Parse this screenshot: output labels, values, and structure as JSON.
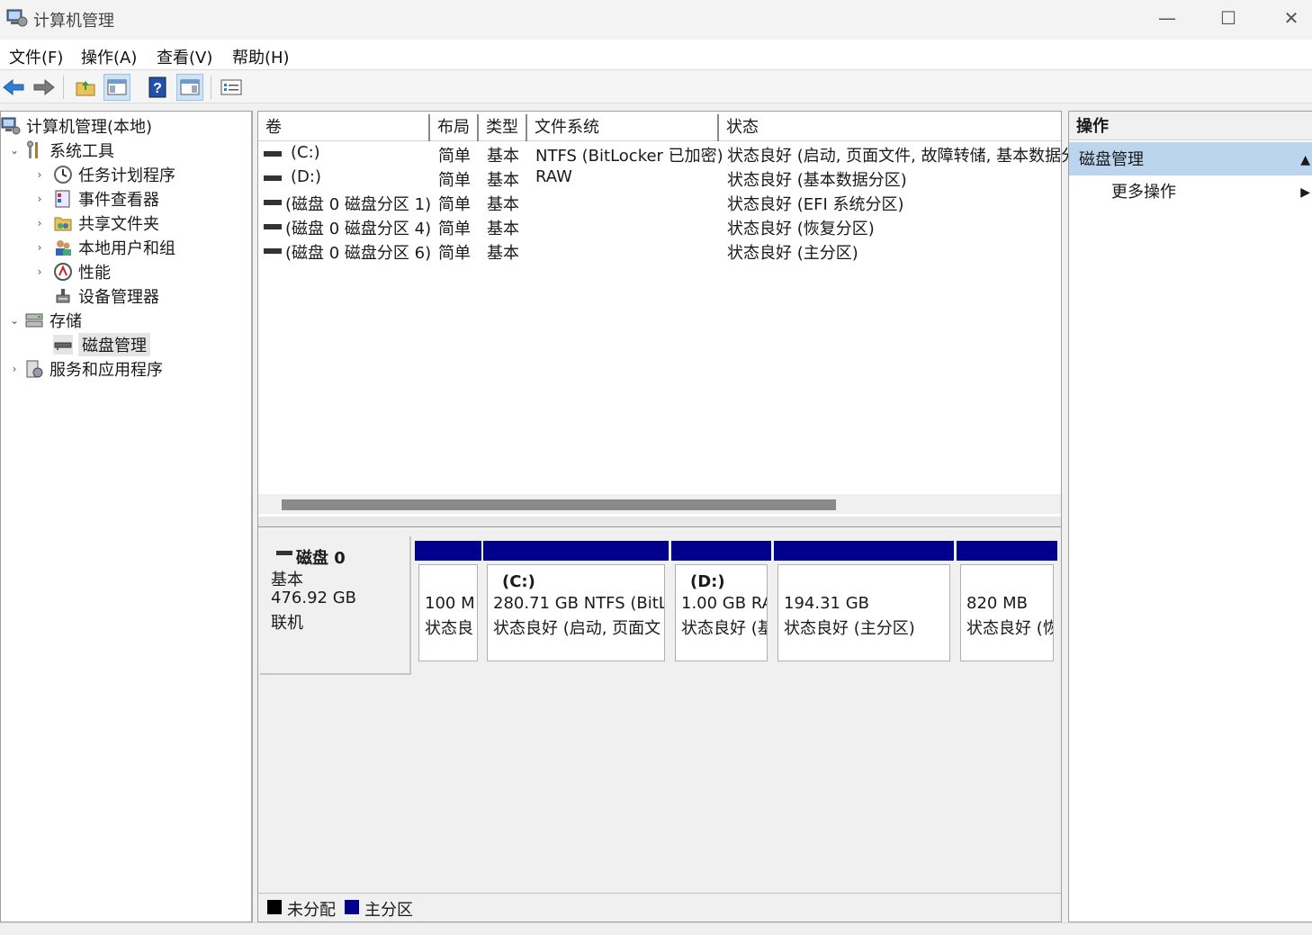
{
  "window": {
    "title": "计算机管理",
    "minimize_icon": "minimize-icon",
    "maximize_icon": "maximize-icon",
    "close_icon": "close-icon"
  },
  "menu": [
    "文件(F)",
    "操作(A)",
    "查看(V)",
    "帮助(H)"
  ],
  "toolbar": [
    "back-arrow-icon",
    "forward-arrow-icon",
    "folder-up-icon",
    "console-tree-icon",
    "help-icon",
    "action-pane-icon",
    "properties-icon"
  ],
  "tree": {
    "root": "计算机管理(本地)",
    "system_tools": "系统工具",
    "task_scheduler": "任务计划程序",
    "event_viewer": "事件查看器",
    "shared_folders": "共享文件夹",
    "local_users": "本地用户和组",
    "performance": "性能",
    "device_manager": "设备管理器",
    "storage": "存储",
    "disk_management": "磁盘管理",
    "services": "服务和应用程序"
  },
  "volume_table": {
    "headers": {
      "volume": "卷",
      "layout": "布局",
      "type": "类型",
      "fs": "文件系统",
      "status": "状态"
    },
    "rows": [
      {
        "volume": "(C:)",
        "layout": "简单",
        "type": "基本",
        "fs": "NTFS (BitLocker 已加密)",
        "status": "状态良好 (启动, 页面文件, 故障转储, 基本数据分"
      },
      {
        "volume": "(D:)",
        "layout": "简单",
        "type": "基本",
        "fs": "RAW",
        "status": "状态良好 (基本数据分区)"
      },
      {
        "volume": "(磁盘 0 磁盘分区 1)",
        "layout": "简单",
        "type": "基本",
        "fs": "",
        "status": "状态良好 (EFI 系统分区)"
      },
      {
        "volume": "(磁盘 0 磁盘分区 4)",
        "layout": "简单",
        "type": "基本",
        "fs": "",
        "status": "状态良好 (恢复分区)"
      },
      {
        "volume": "(磁盘 0 磁盘分区 6)",
        "layout": "简单",
        "type": "基本",
        "fs": "",
        "status": "状态良好 (主分区)"
      }
    ]
  },
  "disk": {
    "name": "磁盘 0",
    "kind": "基本",
    "size": "476.92 GB",
    "state": "联机",
    "partitions": [
      {
        "name": "",
        "size": "100 M",
        "status": "状态良"
      },
      {
        "name": "(C:)",
        "size": "280.71 GB NTFS (BitLo",
        "status": "状态良好 (启动, 页面文"
      },
      {
        "name": "(D:)",
        "size": "1.00 GB RA",
        "status": "状态良好 (基"
      },
      {
        "name": "",
        "size": "194.31 GB",
        "status": "状态良好 (主分区)"
      },
      {
        "name": "",
        "size": "820 MB",
        "status": "状态良好 (恢"
      }
    ]
  },
  "legend": {
    "unallocated": "未分配",
    "primary": "主分区",
    "unallocated_color": "#000000",
    "primary_color": "#00008c"
  },
  "actions": {
    "header": "操作",
    "section": "磁盘管理",
    "more": "更多操作"
  }
}
